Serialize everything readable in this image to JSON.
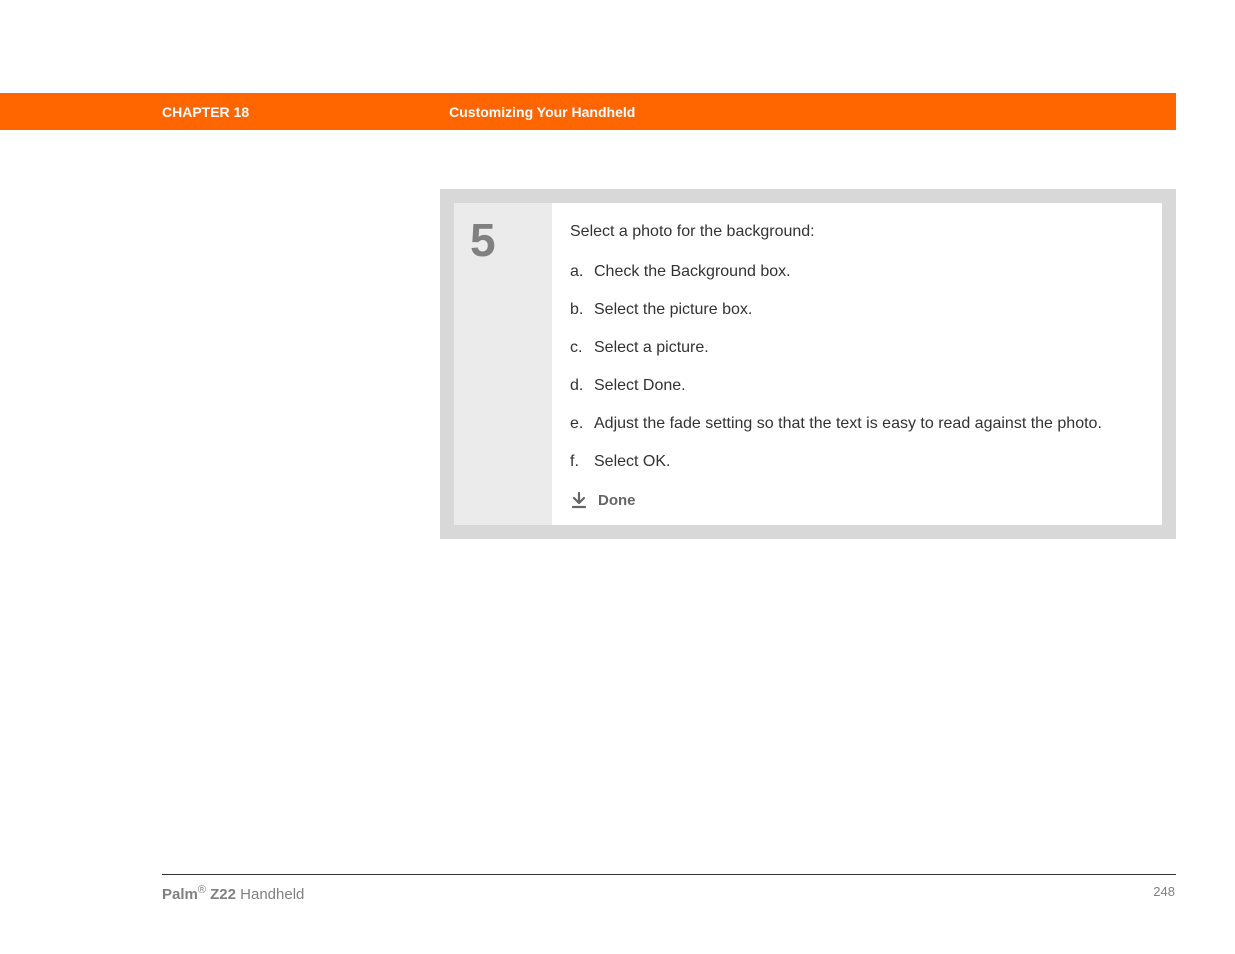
{
  "header": {
    "chapter": "CHAPTER 18",
    "section": "Customizing Your Handheld"
  },
  "step": {
    "number": "5",
    "title": "Select a photo for the background:",
    "items": [
      {
        "marker": "a.",
        "text": "Check the Background box."
      },
      {
        "marker": "b.",
        "text": "Select the picture box."
      },
      {
        "marker": "c.",
        "text": "Select a picture."
      },
      {
        "marker": "d.",
        "text": "Select Done."
      },
      {
        "marker": "e.",
        "text": "Adjust the fade setting so that the text is easy to read against the photo."
      },
      {
        "marker": "f.",
        "text": "Select OK."
      }
    ],
    "done_label": "Done"
  },
  "footer": {
    "brand": "Palm",
    "reg": "®",
    "model": " Z22",
    "product": " Handheld",
    "page": "248"
  }
}
